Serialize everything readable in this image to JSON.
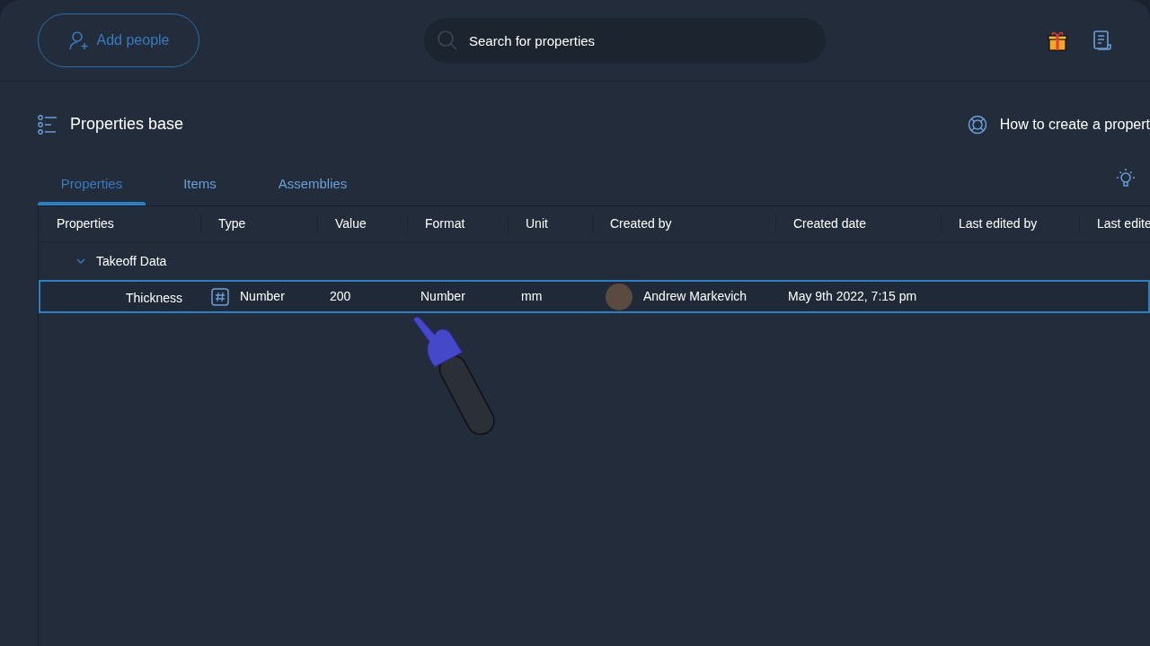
{
  "top_bar": {
    "add_button": "Add people",
    "search": {
      "placeholder": "Search for properties"
    }
  },
  "header": {
    "title": "Properties base",
    "help_link": "How to create a propert"
  },
  "tabs": [
    {
      "label": "Properties",
      "selected": true
    },
    {
      "label": "Items",
      "selected": false
    },
    {
      "label": "Assemblies",
      "selected": false
    }
  ],
  "table": {
    "columns": [
      "Properties",
      "Type",
      "Value",
      "Format",
      "Unit",
      "Created by",
      "Created date",
      "Last edited by",
      "Last edite"
    ],
    "groups": [
      {
        "name": "Takeoff Data",
        "expanded": true,
        "rows": [
          {
            "property": "Thickness",
            "type": "Number",
            "value": "200",
            "format": "Number",
            "unit": "mm",
            "created_by": "Andrew Markevich",
            "created_date": "May 9th 2022, 7:15 pm",
            "selected": true
          }
        ]
      }
    ]
  }
}
